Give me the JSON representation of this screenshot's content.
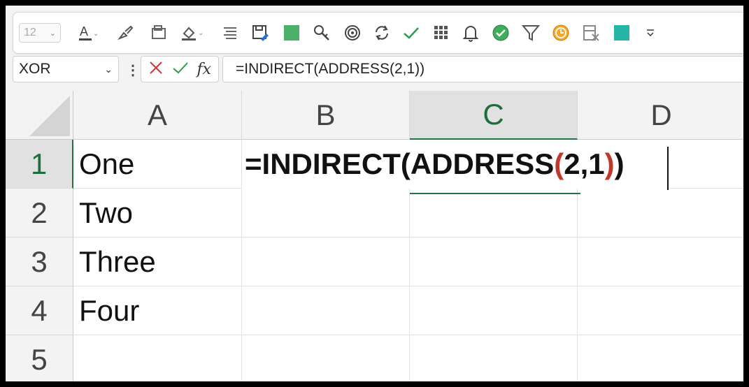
{
  "toolbar": {
    "font_size": "12",
    "icons": [
      "font-color-icon",
      "format-painter-icon",
      "cell-styles-icon",
      "fill-color-icon",
      "align-icon",
      "save-as-icon",
      "green-square-icon",
      "find-icon",
      "target-icon",
      "refresh-icon",
      "checkmark-icon",
      "grid-icon",
      "bell-icon",
      "check-circle-icon",
      "filter-icon",
      "clock-icon",
      "clear-icon",
      "teal-square-icon",
      "more-icon"
    ]
  },
  "formula_bar": {
    "name_box": "XOR",
    "formula": "=INDIRECT(ADDRESS(2,1))",
    "fx_label": "fx"
  },
  "columns": [
    "A",
    "B",
    "C",
    "D"
  ],
  "rows": [
    "1",
    "2",
    "3",
    "4",
    "5"
  ],
  "cells": {
    "A1": "One",
    "A2": "Two",
    "A3": "Three",
    "A4": "Four",
    "A5": ""
  },
  "editing": {
    "prefix": "=INDIRECT(ADDRESS",
    "open_paren": "(",
    "args": "2,1",
    "close_paren": ")",
    "final_paren": ")"
  },
  "colors": {
    "accent": "#217346",
    "paren_highlight": "#c0392b"
  }
}
